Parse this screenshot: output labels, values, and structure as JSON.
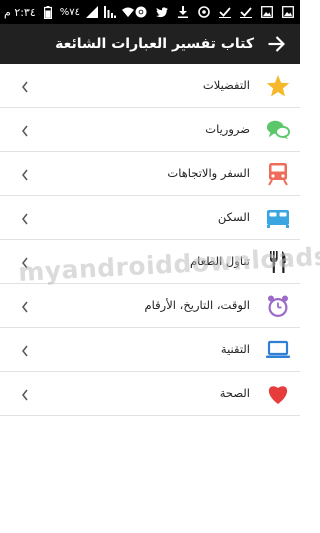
{
  "status_bar": {
    "time": "٢:٣٤ م",
    "battery": "%٧٤",
    "icons": [
      "battery-icon",
      "signal-icon",
      "signal-bars-icon",
      "wifi-icon",
      "chrome-icon",
      "twitter-icon",
      "download-icon",
      "clock-icon",
      "check-icon",
      "check-icon",
      "image-icon",
      "image-icon"
    ]
  },
  "app_bar": {
    "title": "كتاب تفسير العبارات الشائعة",
    "back_icon": "arrow-forward-icon"
  },
  "list": [
    {
      "label": "التفضيلات",
      "icon": "star-icon",
      "color": "#f6b82a"
    },
    {
      "label": "ضروريات",
      "icon": "chat-bubbles-icon",
      "color": "#5ac86a"
    },
    {
      "label": "السفر والاتجاهات",
      "icon": "train-icon",
      "color": "#ef6b5a"
    },
    {
      "label": "السكن",
      "icon": "bed-icon",
      "color": "#3aa5e0"
    },
    {
      "label": "تناول الطعام",
      "icon": "fork-knife-icon",
      "color": "#222222"
    },
    {
      "label": "الوقت، التاريخ، الأرقام",
      "icon": "alarm-clock-icon",
      "color": "#9c6bc9"
    },
    {
      "label": "التقنية",
      "icon": "laptop-icon",
      "color": "#2f7fd6"
    },
    {
      "label": "الصحة",
      "icon": "heart-icon",
      "color": "#e63c3c"
    }
  ],
  "watermark": "myandroiddownloads.com",
  "colors": {
    "status_bar": "#000000",
    "app_bar": "#212121",
    "divider": "#e2e2e2"
  }
}
